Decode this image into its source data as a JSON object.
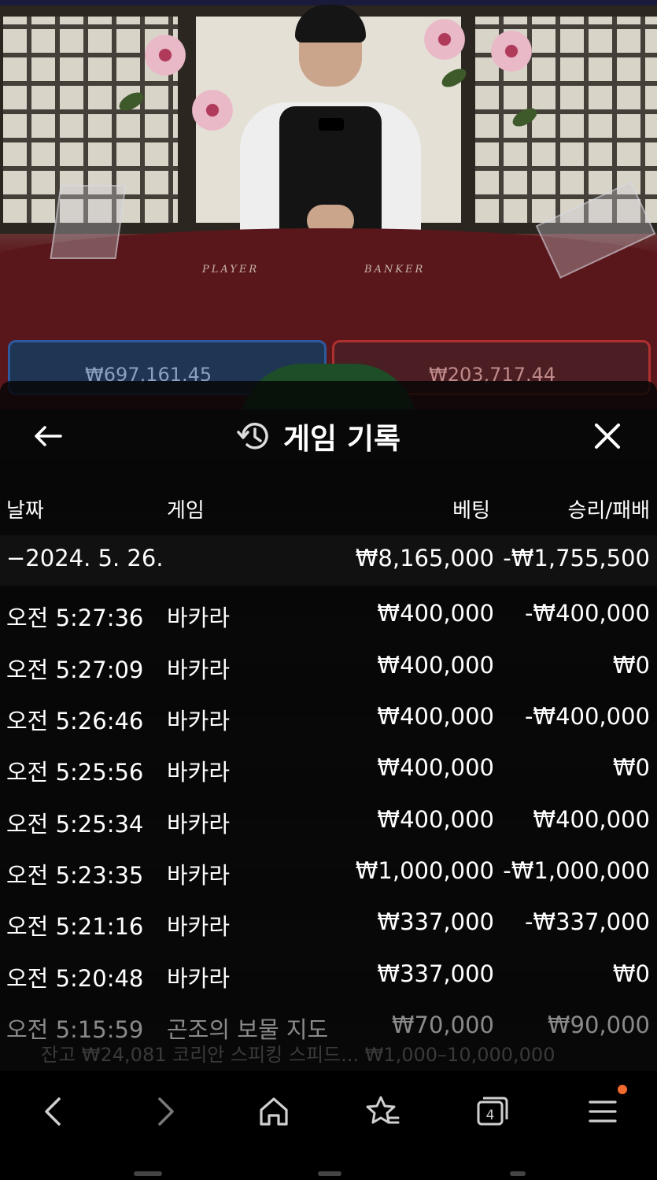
{
  "video": {
    "table_labels": [
      "PLAYER",
      "BANKER"
    ],
    "player_total": "₩697,161.45",
    "banker_total": "₩203,717.44"
  },
  "header": {
    "title": "게임 기록",
    "back_icon": "arrow-left-icon",
    "history_icon": "history-clock-icon",
    "close_icon": "close-icon"
  },
  "columns": {
    "date": "날짜",
    "game": "게임",
    "bet": "베팅",
    "win_loss": "승리/패배"
  },
  "summary": {
    "date": "−2024. 5. 26.",
    "bet": "₩8,165,000",
    "win_loss": "-₩1,755,500"
  },
  "rows": [
    {
      "time": "오전 5:27:36",
      "game": "바카라",
      "bet": "₩400,000",
      "result": "-₩400,000"
    },
    {
      "time": "오전 5:27:09",
      "game": "바카라",
      "bet": "₩400,000",
      "result": "₩0"
    },
    {
      "time": "오전 5:26:46",
      "game": "바카라",
      "bet": "₩400,000",
      "result": "-₩400,000"
    },
    {
      "time": "오전 5:25:56",
      "game": "바카라",
      "bet": "₩400,000",
      "result": "₩0"
    },
    {
      "time": "오전 5:25:34",
      "game": "바카라",
      "bet": "₩400,000",
      "result": "₩400,000"
    },
    {
      "time": "오전 5:23:35",
      "game": "바카라",
      "bet": "₩1,000,000",
      "result": "-₩1,000,000"
    },
    {
      "time": "오전 5:21:16",
      "game": "바카라",
      "bet": "₩337,000",
      "result": "-₩337,000"
    },
    {
      "time": "오전 5:20:48",
      "game": "바카라",
      "bet": "₩337,000",
      "result": "₩0"
    },
    {
      "time": "오전 5:15:59",
      "game": "곤조의 보물 지도",
      "bet": "₩70,000",
      "result": "₩90,000"
    }
  ],
  "footer_ghost": "잔고 ₩24,081   코리안 스피킹 스피드...  ₩1,000–10,000,000",
  "browser_nav": {
    "back_icon": "chevron-left-icon",
    "forward_icon": "chevron-right-icon",
    "home_icon": "home-icon",
    "bookmarks_icon": "star-list-icon",
    "tabs_icon": "tabs-icon",
    "tabs_count": "4",
    "menu_icon": "menu-icon",
    "notification_color": "#f26a2e"
  }
}
